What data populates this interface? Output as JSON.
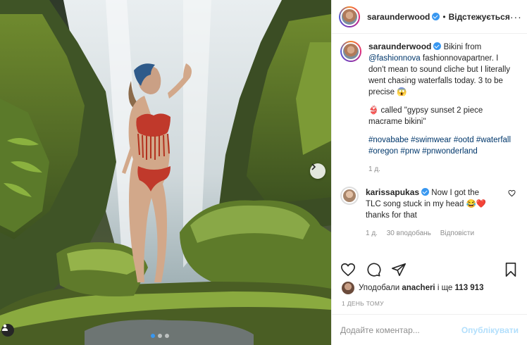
{
  "header": {
    "username": "saraunderwood",
    "separator": "•",
    "follow_label": "Відстежується",
    "more_label": "···"
  },
  "caption": {
    "username": "saraunderwood",
    "text_intro": "Bikini from",
    "mention": "@fashionnova",
    "text_partner": "fashionnovapartner. I don't mean to sound cliche but I literally went chasing waterfalls today. 3 to be precise 😱",
    "bikini_line": "👙 called \"gypsy sunset 2 piece macrame bikini\"",
    "hashtags": [
      "#novababe",
      "#swimwear",
      "#ootd",
      "#waterfall",
      "#oregon",
      "#pnw",
      "#pnwonderland"
    ],
    "time": "1 д."
  },
  "comment": {
    "username": "karissapukas",
    "text": "Now I got the TLC song stuck in my head 😂❤️ thanks for that",
    "time": "1 д.",
    "likes": "30 вподобань",
    "reply": "Відповісти"
  },
  "likes": {
    "prefix": "Уподобали",
    "user": "anacheri",
    "suffix": "і ще",
    "count": "113 913"
  },
  "date": "1 ДЕНЬ ТОМУ",
  "add_comment": {
    "placeholder": "Додайте коментар...",
    "publish_label": "Опублікувати"
  },
  "icons": {
    "like": "heart-icon",
    "comment": "comment-icon",
    "share": "share-icon",
    "save": "bookmark-icon",
    "next": "chevron-right-icon",
    "tag": "user-tag-icon"
  },
  "colors": {
    "link": "#00376b",
    "verified": "#3897f0",
    "muted": "#8e8e8e",
    "publish_disabled": "#b2dffc"
  },
  "carousel": {
    "current": 1,
    "total": 3
  }
}
